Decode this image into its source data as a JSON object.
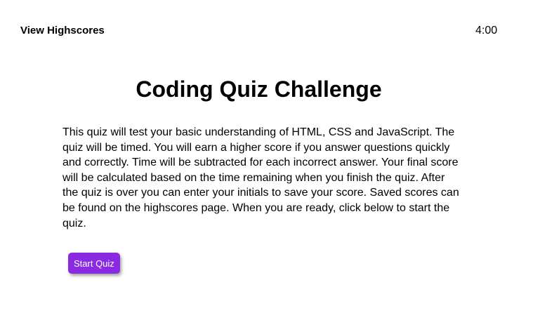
{
  "header": {
    "highscores_link": "View Highscores",
    "timer": "4:00"
  },
  "main": {
    "title": "Coding Quiz Challenge",
    "intro": "This quiz will test your basic understanding of HTML, CSS and JavaScript. The quiz will be timed. You will earn a higher score if you answer questions quickly and correctly. Time will be subtracted for each incorrect answer. Your final score will be calculated based on the time remaining when you finish the quiz. After the quiz is over you can enter your initials to save your score. Saved scores can be found on the highscores page. When you are ready, click below to start the quiz.",
    "start_label": "Start Quiz"
  },
  "colors": {
    "accent": "#8a2be2"
  }
}
